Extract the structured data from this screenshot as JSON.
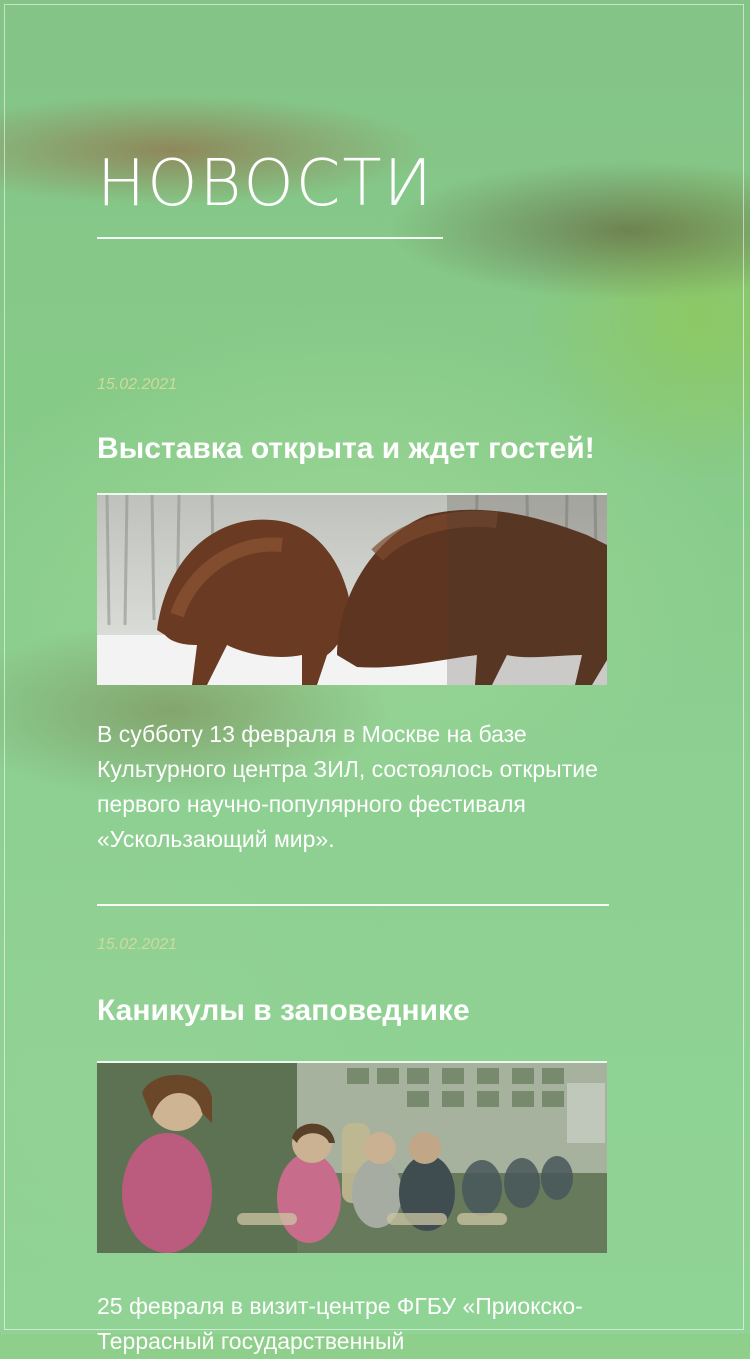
{
  "page": {
    "title": "НОВОСТИ"
  },
  "news": [
    {
      "date": "15.02.2021",
      "title": "Выставка открыта и ждет гостей!",
      "image_icon": "bison-fighting-photo",
      "text": "В субботу 13 февраля в Москве на базе Культурного центра ЗИЛ, состоялось открытие первого научно-популярного фестиваля «Ускользающий мир»."
    },
    {
      "date": "15.02.2021",
      "title": "Каникулы в заповеднике",
      "image_icon": "children-audience-photo",
      "text": "25 февраля в визит-центре ФГБУ «Приокско-Террасный государственный"
    }
  ],
  "colors": {
    "background_green": "#8fcf8c",
    "date_text": "#cddb9c",
    "text": "#ffffff"
  }
}
